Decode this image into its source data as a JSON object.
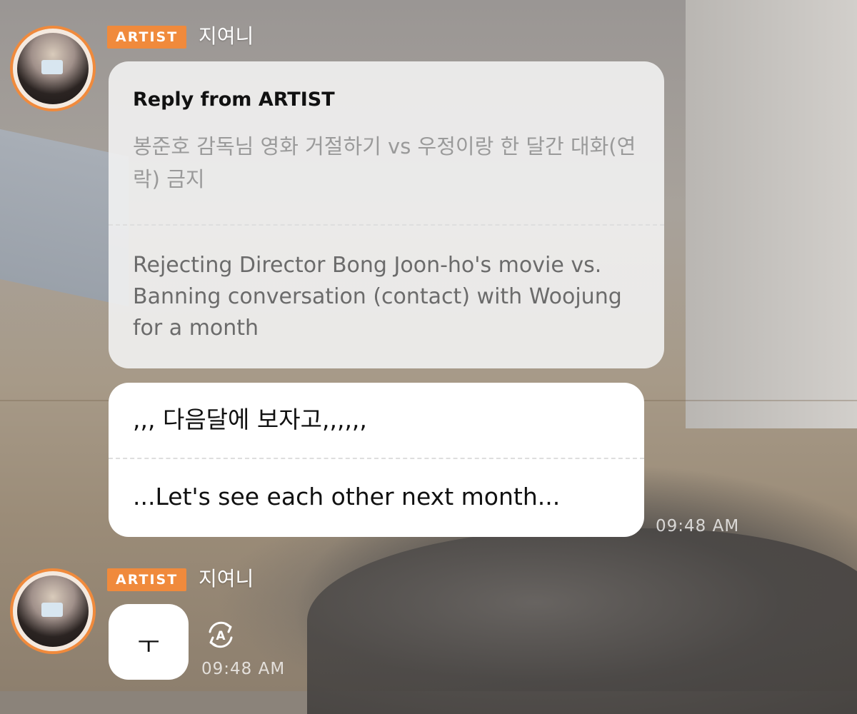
{
  "messages": [
    {
      "badge": "ARTIST",
      "name": "지여니",
      "reply": {
        "title": "Reply from ARTIST",
        "original": "봉준호 감독님 영화 거절하기 vs 우정이랑 한 달간 대화(연락) 금지",
        "translation": "Rejecting Director Bong Joon-ho's movie vs. Banning conversation (contact) with Woojung for a month"
      },
      "text": ",,, 다음달에 보자고,,,,,,",
      "translation": "...Let's see each other next month...",
      "time": "09:48 AM"
    },
    {
      "badge": "ARTIST",
      "name": "지여니",
      "text": "ㅜ",
      "time": "09:48 AM",
      "icon": "translate-icon"
    }
  ],
  "colors": {
    "badge": "#f08a3c",
    "avatar_ring": "#f08a3c",
    "reply_bubble": "#f4f4f4",
    "bubble": "#ffffff"
  }
}
